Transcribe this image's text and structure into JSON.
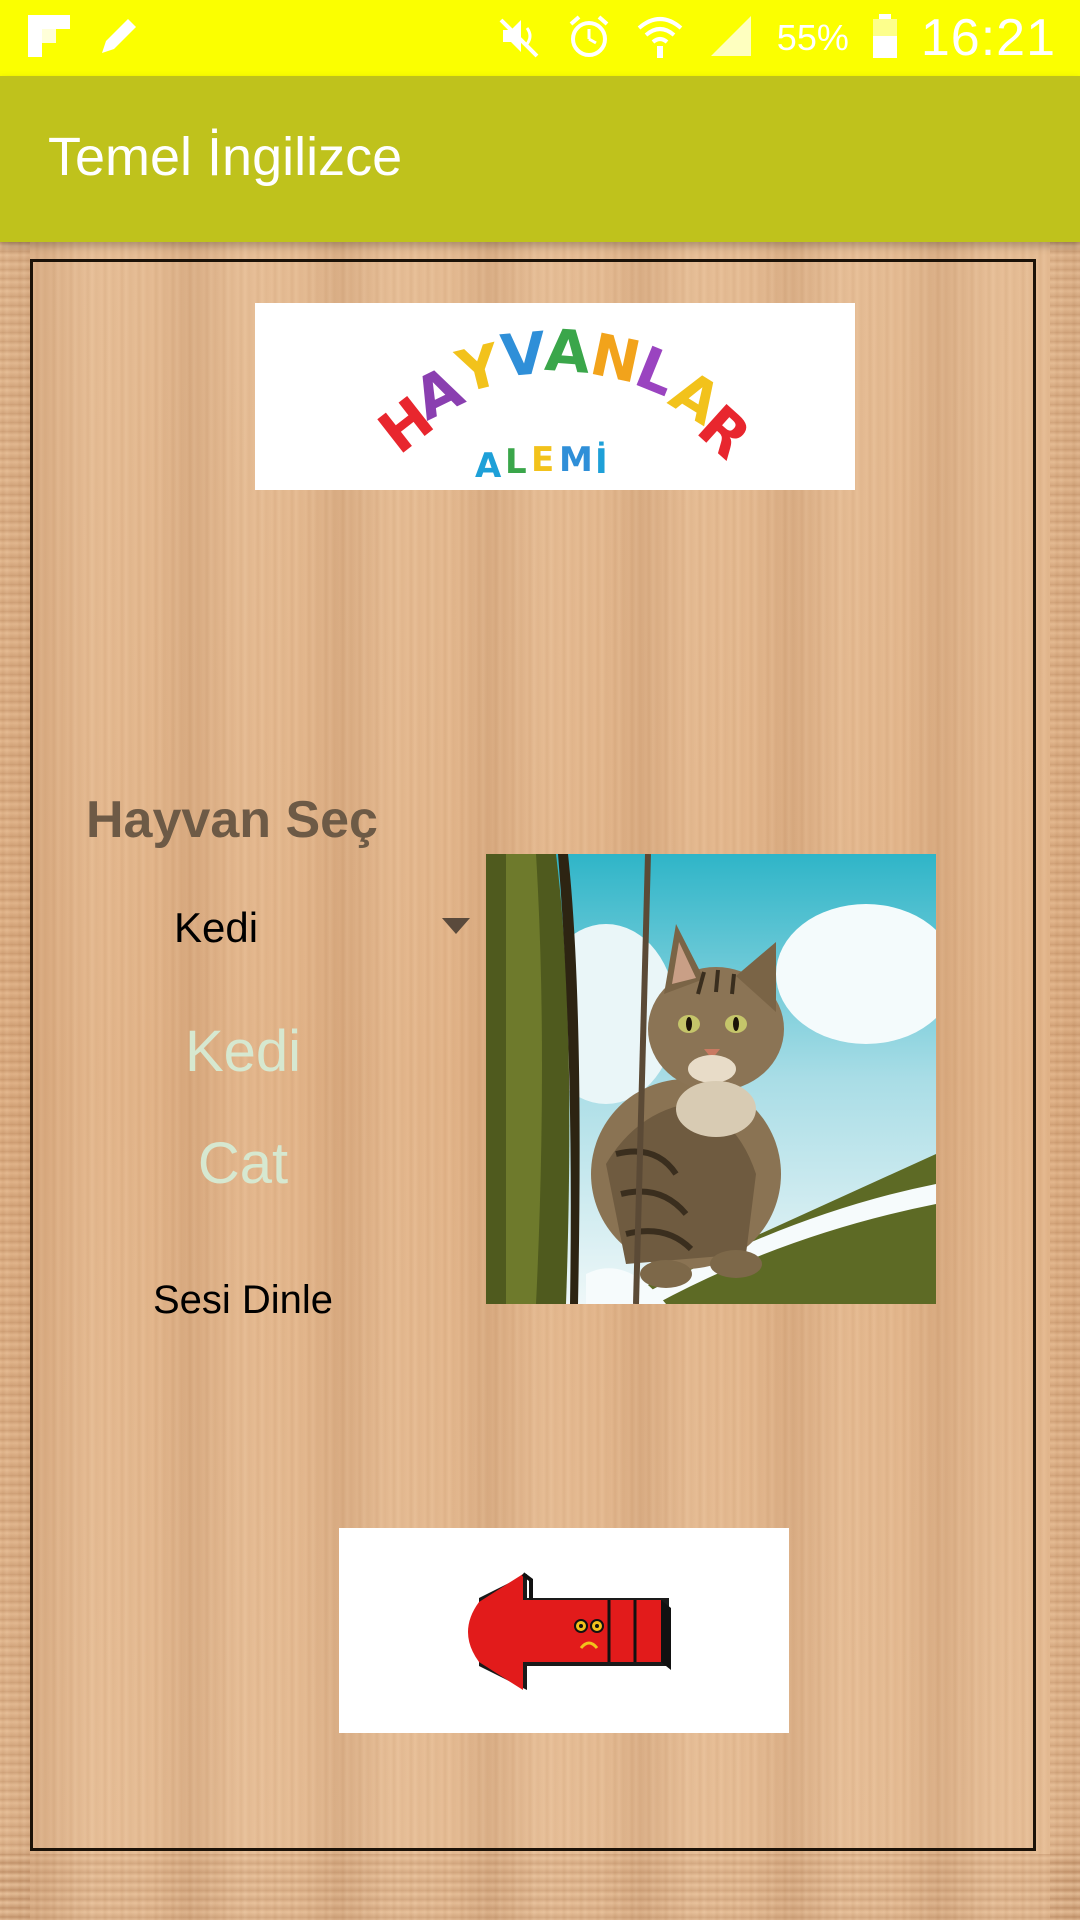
{
  "status_bar": {
    "battery_percent": "55%",
    "time": "16:21",
    "icons": [
      "flipboard-icon",
      "pencil-icon",
      "mute-icon",
      "alarm-icon",
      "wifi-icon",
      "signal-icon",
      "battery-icon"
    ]
  },
  "app_bar": {
    "title": "Temel İngilizce"
  },
  "logo": {
    "line1": "HAYVANLAR",
    "line2": "ALEMİ"
  },
  "animal_select": {
    "label": "Hayvan Seç",
    "selected": "Kedi"
  },
  "word": {
    "turkish": "Kedi",
    "english": "Cat"
  },
  "listen_button": {
    "label": "Sesi Dinle"
  },
  "photo": {
    "subject": "cat"
  },
  "back_button": {
    "icon": "back-arrow-icon"
  },
  "colors": {
    "status_bar": "#fbff00",
    "app_bar": "#bfc21c",
    "word_text": "#d6e8d0",
    "label_text": "#6d5a46"
  }
}
